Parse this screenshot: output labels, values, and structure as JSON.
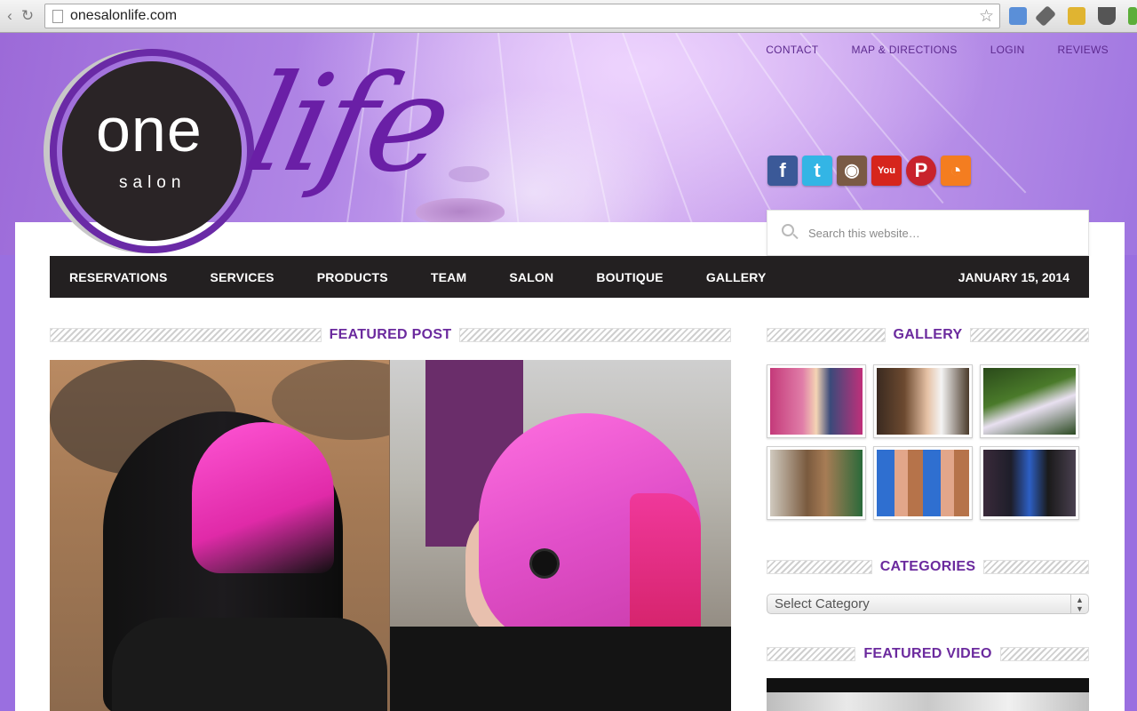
{
  "browser": {
    "url": "onesalonlife.com",
    "back_icon": "back-arrow-icon",
    "reload_icon": "reload-icon",
    "bookmark_icon": "star-icon"
  },
  "top_links": [
    "CONTACT",
    "MAP & DIRECTIONS",
    "LOGIN",
    "REVIEWS"
  ],
  "logo": {
    "one": "one",
    "salon": "salon",
    "life": "life"
  },
  "social": [
    {
      "name": "facebook-icon",
      "glyph": "f",
      "color": "#3b5998"
    },
    {
      "name": "twitter-icon",
      "glyph": "t",
      "color": "#33b5e5"
    },
    {
      "name": "instagram-icon",
      "glyph": "◉",
      "color": "#7a5a44"
    },
    {
      "name": "youtube-icon",
      "glyph": "You",
      "color": "#d6251c"
    },
    {
      "name": "pinterest-icon",
      "glyph": "P",
      "color": "#c8232c"
    },
    {
      "name": "rss-icon",
      "glyph": "◔",
      "color": "#f47d20"
    }
  ],
  "search": {
    "placeholder": "Search this website…"
  },
  "nav": {
    "items": [
      "RESERVATIONS",
      "SERVICES",
      "PRODUCTS",
      "TEAM",
      "SALON",
      "BOUTIQUE",
      "GALLERY"
    ],
    "date": "JANUARY 15, 2014"
  },
  "sections": {
    "featured_post": "FEATURED POST",
    "gallery": "GALLERY",
    "categories": "CATEGORIES",
    "featured_video": "FEATURED VIDEO"
  },
  "categories": {
    "selected": "Select Category"
  },
  "colors": {
    "accent": "#6b2a9e",
    "nav_bg": "#232021",
    "header_bg": "#9a6fe0"
  }
}
